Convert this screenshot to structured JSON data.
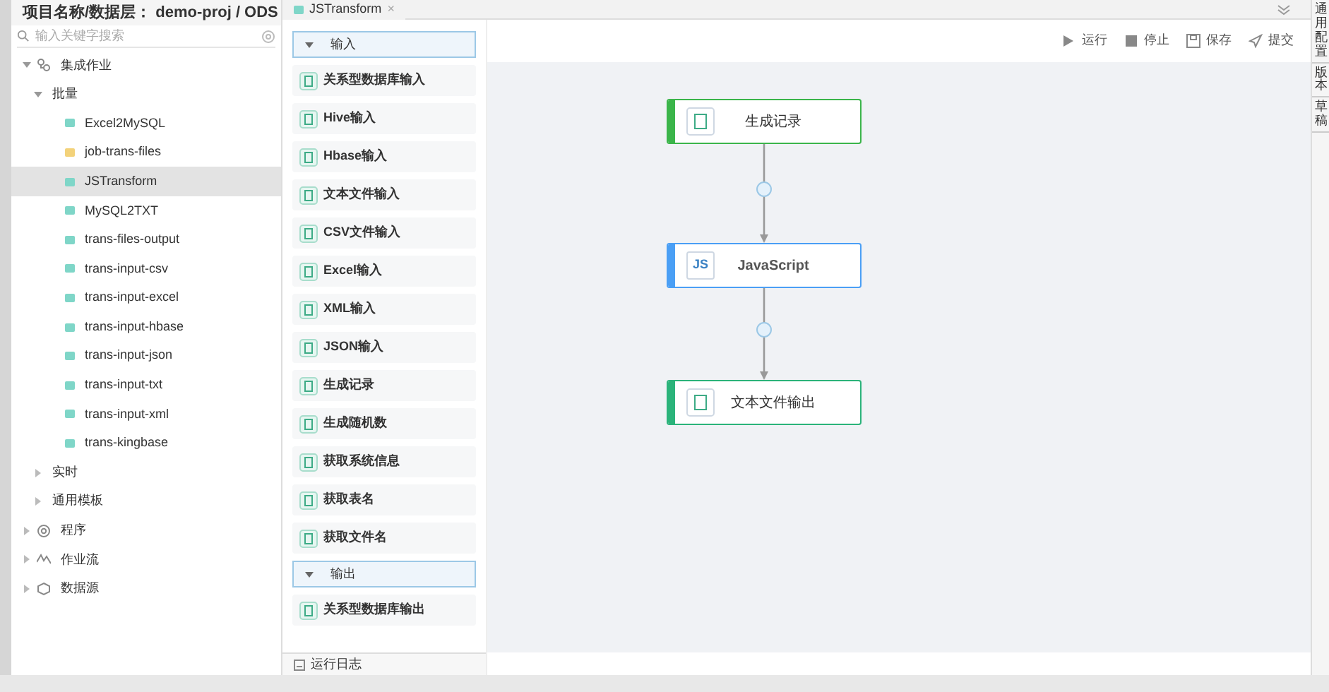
{
  "project_title": "项目名称/数据层： demo-proj / ODS",
  "search": {
    "placeholder": "输入关键字搜索"
  },
  "tree": [
    {
      "label": "集成作业",
      "kind": "nodes",
      "expanded": true,
      "children": [
        {
          "label": "批量",
          "expanded": true,
          "children": [
            {
              "label": "Excel2MySQL",
              "color": "#7fd6c8",
              "selected": false
            },
            {
              "label": "job-trans-files",
              "color": "#f3d27a",
              "selected": false
            },
            {
              "label": "JSTransform",
              "color": "#7fd6c8",
              "selected": true
            },
            {
              "label": "MySQL2TXT",
              "color": "#7fd6c8",
              "selected": false
            },
            {
              "label": "trans-files-output",
              "color": "#7fd6c8",
              "selected": false
            },
            {
              "label": "trans-input-csv",
              "color": "#7fd6c8",
              "selected": false
            },
            {
              "label": "trans-input-excel",
              "color": "#7fd6c8",
              "selected": false
            },
            {
              "label": "trans-input-hbase",
              "color": "#7fd6c8",
              "selected": false
            },
            {
              "label": "trans-input-json",
              "color": "#7fd6c8",
              "selected": false
            },
            {
              "label": "trans-input-txt",
              "color": "#7fd6c8",
              "selected": false
            },
            {
              "label": "trans-input-xml",
              "color": "#7fd6c8",
              "selected": false
            },
            {
              "label": "trans-kingbase",
              "color": "#7fd6c8",
              "selected": false
            }
          ]
        },
        {
          "label": "实时",
          "expanded": false
        },
        {
          "label": "通用模板",
          "expanded": false
        }
      ]
    },
    {
      "label": "程序",
      "kind": "gear",
      "expanded": false
    },
    {
      "label": "作业流",
      "kind": "flow",
      "expanded": false
    },
    {
      "label": "数据源",
      "kind": "cube",
      "expanded": false
    }
  ],
  "tab": {
    "label": "JSTransform",
    "close": "×"
  },
  "palette": [
    {
      "kind": "header",
      "label": "输入",
      "expanded": true
    },
    {
      "kind": "item",
      "label": "关系型数据库输入"
    },
    {
      "kind": "item",
      "label": "Hive输入"
    },
    {
      "kind": "item",
      "label": "Hbase输入"
    },
    {
      "kind": "item",
      "label": "文本文件输入"
    },
    {
      "kind": "item",
      "label": "CSV文件输入"
    },
    {
      "kind": "item",
      "label": "Excel输入"
    },
    {
      "kind": "item",
      "label": "XML输入"
    },
    {
      "kind": "item",
      "label": "JSON输入"
    },
    {
      "kind": "item",
      "label": "生成记录"
    },
    {
      "kind": "item",
      "label": "生成随机数"
    },
    {
      "kind": "item",
      "label": "获取系统信息"
    },
    {
      "kind": "item",
      "label": "获取表名"
    },
    {
      "kind": "item",
      "label": "获取文件名"
    },
    {
      "kind": "header",
      "label": "输出",
      "expanded": true
    },
    {
      "kind": "item",
      "label": "关系型数据库输出"
    }
  ],
  "log_button": "运行日志",
  "toolbar": [
    {
      "kind": "run",
      "label": "运行"
    },
    {
      "kind": "stop",
      "label": "停止"
    },
    {
      "kind": "save",
      "label": "保存"
    },
    {
      "kind": "submit",
      "label": "提交"
    }
  ],
  "nodes": [
    {
      "label": "生成记录",
      "color": "#3bb54a"
    },
    {
      "label": "JavaScript",
      "color": "#4a9ff5",
      "badge": "JS"
    },
    {
      "label": "文本文件输出",
      "color": "#2bb37a"
    }
  ],
  "right_tabs": [
    "通用配置",
    "版本",
    "草稿"
  ]
}
